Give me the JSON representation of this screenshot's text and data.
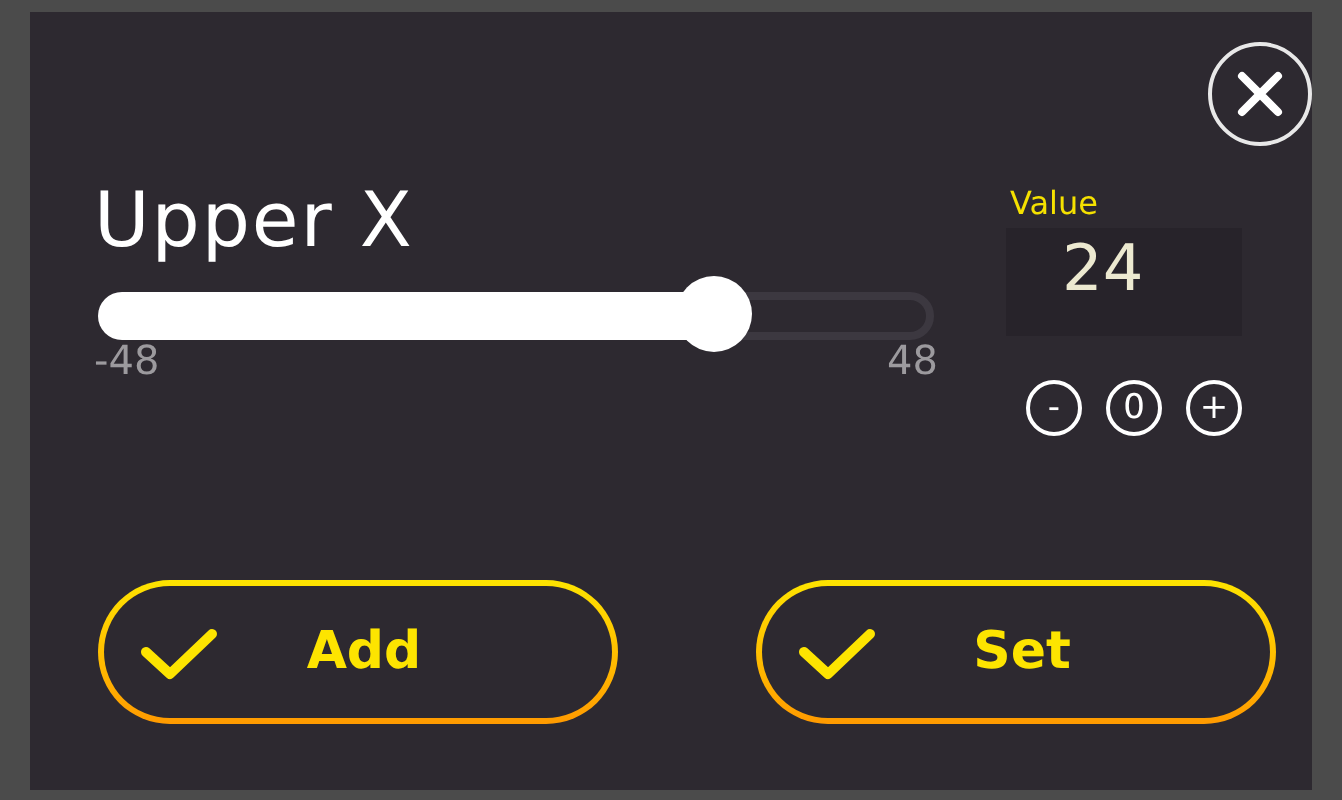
{
  "dialog": {
    "title": "Upper X"
  },
  "slider": {
    "level": 0.75,
    "min_label": "-48",
    "max_label": "48"
  },
  "value_box": {
    "label": "Value",
    "value": "24"
  },
  "steppers": [
    {
      "label": "-"
    },
    {
      "label": "0"
    },
    {
      "label": "+"
    }
  ],
  "buttons": [
    {
      "label": "Add"
    },
    {
      "label": "Set"
    }
  ]
}
